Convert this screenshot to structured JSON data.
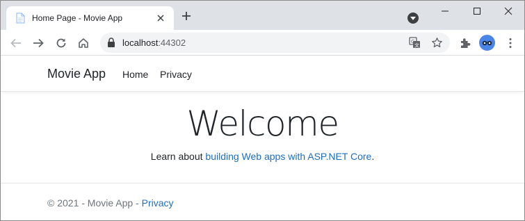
{
  "browser": {
    "tab": {
      "title": "Home Page - Movie App"
    },
    "address": {
      "host": "localhost",
      "port": ":44302"
    },
    "colors": {
      "tabstrip": "#dee1e6",
      "omnibox": "#f1f3f4",
      "avatar": "#4a86e8"
    },
    "icons": [
      "page-favicon-icon",
      "close-icon",
      "plus-icon",
      "tab-search-icon",
      "minimize-icon",
      "maximize-icon",
      "window-close-icon",
      "back-arrow-icon",
      "forward-arrow-icon",
      "reload-icon",
      "home-icon",
      "lock-icon",
      "translate-icon",
      "star-icon",
      "puzzle-icon",
      "kebab-menu-icon"
    ]
  },
  "site": {
    "brand": "Movie App",
    "nav": {
      "home": "Home",
      "privacy": "Privacy"
    },
    "hero": {
      "heading": "Welcome",
      "learn_prefix": "Learn about ",
      "learn_link": "building Web apps with ASP.NET Core",
      "learn_suffix": "."
    },
    "footer": {
      "prefix": "© 2021 - Movie App - ",
      "privacy_link": "Privacy"
    },
    "colors": {
      "link": "#1b6ec2",
      "muted": "#6c757d",
      "text": "#212529"
    }
  }
}
